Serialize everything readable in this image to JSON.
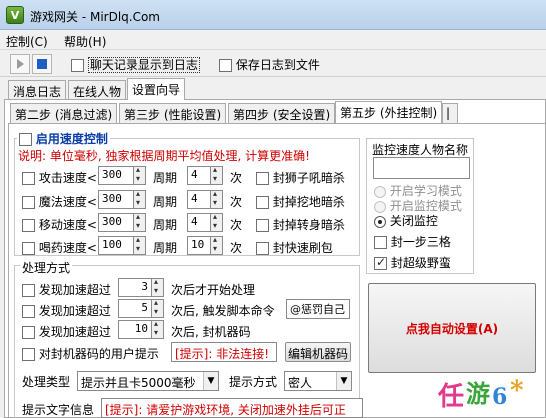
{
  "window": {
    "title": "游戏网关 - MirDlq.Com",
    "icon_letter": "V"
  },
  "menu": {
    "items": [
      {
        "label": "控制(C)"
      },
      {
        "label": "帮助(H)"
      }
    ]
  },
  "toolbar": {
    "play": "play-icon",
    "stop": "stop-icon",
    "chat_log_label": "聊天记录显示到日志",
    "chat_log_checked": false,
    "save_log_label": "保存日志到文件",
    "save_log_checked": false
  },
  "main_tabs": [
    {
      "label": "消息日志"
    },
    {
      "label": "在线人物"
    },
    {
      "label": "设置向导"
    }
  ],
  "step_tabs": [
    {
      "label": "第二步 (消息过滤)"
    },
    {
      "label": "第三步 (性能设置)"
    },
    {
      "label": "第四步 (安全设置)"
    },
    {
      "label": "第五步 (外挂控制)"
    }
  ],
  "speed": {
    "enable_label": "启用速度控制",
    "enable_checked": false,
    "note": "说明: 单位毫秒, 独家根据周期平均值处理, 计算更准确!",
    "rows": [
      {
        "label": "攻击速度<",
        "ms": "300",
        "period_label": "周期",
        "count": "4",
        "unit": "次",
        "extra": "封狮子吼暗杀"
      },
      {
        "label": "魔法速度<",
        "ms": "300",
        "period_label": "周期",
        "count": "4",
        "unit": "次",
        "extra": "封掉挖地暗杀"
      },
      {
        "label": "移动速度<",
        "ms": "300",
        "period_label": "周期",
        "count": "4",
        "unit": "次",
        "extra": "封掉转身暗杀"
      },
      {
        "label": "喝药速度<",
        "ms": "100",
        "period_label": "周期",
        "count": "10",
        "unit": "次",
        "extra": "封快速刷包"
      }
    ]
  },
  "monitor": {
    "title": "监控速度人物名称",
    "options": [
      {
        "label": "开启学习模式",
        "state": "disabled"
      },
      {
        "label": "开启监控模式",
        "state": "disabled"
      },
      {
        "label": "关闭监控",
        "state": "selected"
      }
    ],
    "three_step_label": "封一步三格",
    "three_step_checked": false,
    "super_label": "封超级野蛮",
    "super_checked": true
  },
  "handle": {
    "title": "处理方式",
    "rows": [
      {
        "label": "发现加速超过",
        "value": "3",
        "suffix": "次后才开始处理"
      },
      {
        "label": "发现加速超过",
        "value": "5",
        "suffix": "次后, 触发脚本命令",
        "command": "@惩罚自己"
      },
      {
        "label": "发现加速超过",
        "value": "10",
        "suffix": "次后, 封机器码"
      }
    ],
    "machine_label": "对封机器码的用户提示",
    "machine_hint": "[提示]: 非法连接!",
    "edit_machine_button": "编辑机器码",
    "type_label": "处理类型",
    "type_value": "提示并且卡5000毫秒",
    "hint_mode_label": "提示方式",
    "hint_mode_value": "密人",
    "hint_text_label": "提示文字信息",
    "hint_text_value": "[提示]: 请爱护游戏环境, 关闭加速外挂后可正"
  },
  "auto_button": "点我自动设置(A)",
  "watermark": "任游"
}
